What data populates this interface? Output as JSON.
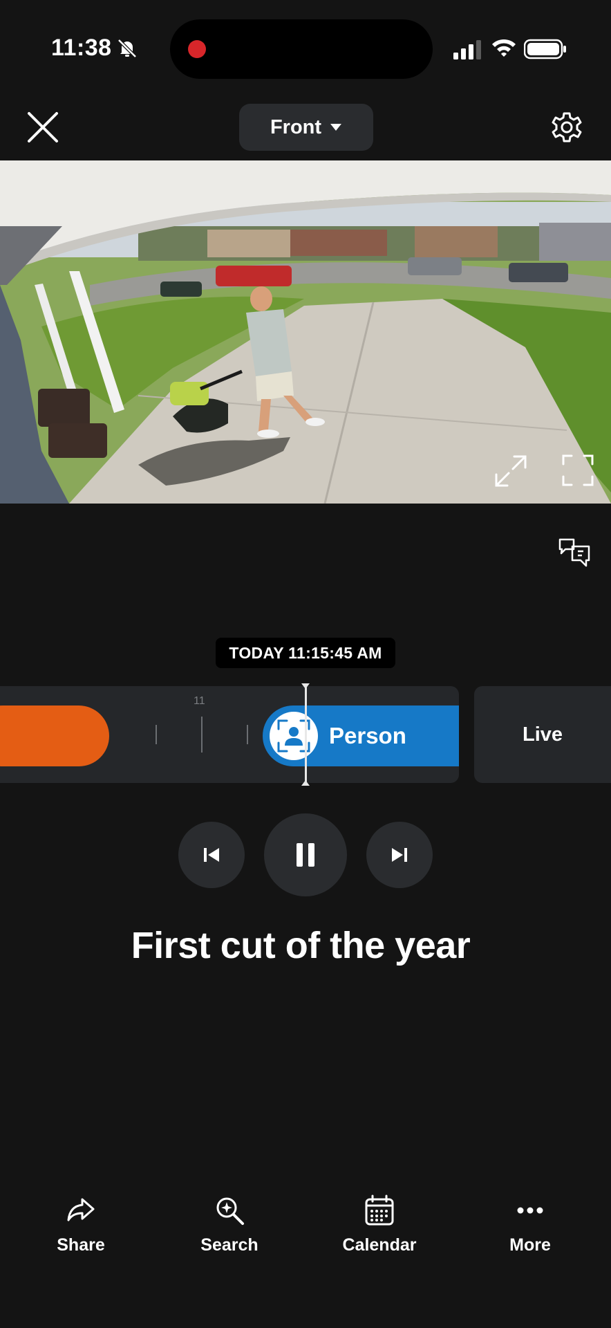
{
  "status_bar": {
    "time": "11:38"
  },
  "header": {
    "camera_name": "Front"
  },
  "timeline": {
    "timestamp": "TODAY 11:15:45 AM",
    "tick_label": "11",
    "event_label": "Person",
    "live_label": "Live"
  },
  "event": {
    "title": "First cut of the year"
  },
  "bottom_nav": {
    "share": "Share",
    "search": "Search",
    "calendar": "Calendar",
    "more": "More"
  },
  "colors": {
    "background": "#141414",
    "person_event": "#1679c7",
    "motion_event": "#e45d14",
    "recording": "#d8262a"
  }
}
